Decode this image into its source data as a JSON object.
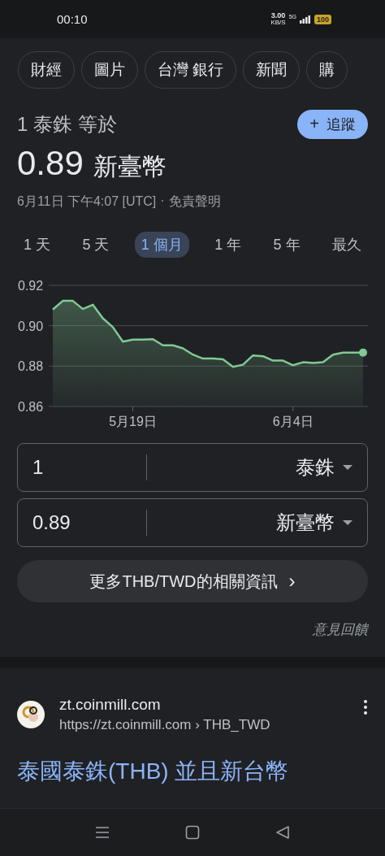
{
  "status_bar": {
    "time": "00:10",
    "net_speed": "3.00",
    "net_unit": "KB/S",
    "network": "5G",
    "battery": "100"
  },
  "chips": [
    {
      "label": "財經"
    },
    {
      "label": "圖片"
    },
    {
      "label": "台灣 銀行"
    },
    {
      "label": "新聞"
    },
    {
      "label": "購"
    }
  ],
  "converter": {
    "heading": "1 泰銖 等於",
    "follow_button": {
      "icon": "+",
      "label": "追蹤"
    },
    "result": "0.89",
    "result_currency": "新臺幣",
    "timestamp": "6月11日 下午4:07 [UTC]",
    "separator": "·",
    "disclaimer": "免責聲明",
    "ranges": [
      {
        "label": "1 天",
        "selected": false
      },
      {
        "label": "5 天",
        "selected": false
      },
      {
        "label": "1 個月",
        "selected": true
      },
      {
        "label": "1 年",
        "selected": false
      },
      {
        "label": "5 年",
        "selected": false
      },
      {
        "label": "最久",
        "selected": false
      }
    ],
    "chart_data": {
      "type": "area",
      "categories": [
        null,
        null,
        null,
        null,
        null,
        null,
        null,
        null,
        "5月19日",
        null,
        null,
        null,
        null,
        null,
        null,
        null,
        null,
        null,
        null,
        null,
        null,
        null,
        null,
        null,
        "6月4日",
        null,
        null,
        null,
        null,
        null,
        null,
        null
      ],
      "series": [
        {
          "color": "#81c995",
          "values": [
            0.908,
            0.9123,
            0.9123,
            0.9083,
            0.9104,
            0.9037,
            0.8993,
            0.8921,
            0.8931,
            0.8931,
            0.8933,
            0.8903,
            0.8903,
            0.8888,
            0.8857,
            0.8837,
            0.8837,
            0.8833,
            0.8796,
            0.8807,
            0.8853,
            0.8849,
            0.8827,
            0.8827,
            0.8804,
            0.8819,
            0.8816,
            0.882,
            0.8857,
            0.8867,
            0.8867,
            0.8867
          ]
        }
      ],
      "ylim": [
        0.86,
        0.92
      ],
      "yticks": [
        {
          "value": 0.92,
          "label": "0.92"
        },
        {
          "value": 0.9,
          "label": "0.90"
        },
        {
          "value": 0.88,
          "label": "0.88"
        },
        {
          "value": 0.86,
          "label": "0.86"
        }
      ]
    },
    "rows": [
      {
        "value": "1",
        "currency": "泰銖"
      },
      {
        "value": "0.89",
        "currency": "新臺幣"
      }
    ],
    "more_button": {
      "label": "更多THB/TWD的相關資訊",
      "icon": "›"
    },
    "feedback": "意見回饋"
  },
  "result": {
    "site": "zt.coinmill.com",
    "url": "https://zt.coinmill.com › THB_TWD",
    "title": "泰國泰銖(THB) 並且新台幣"
  }
}
